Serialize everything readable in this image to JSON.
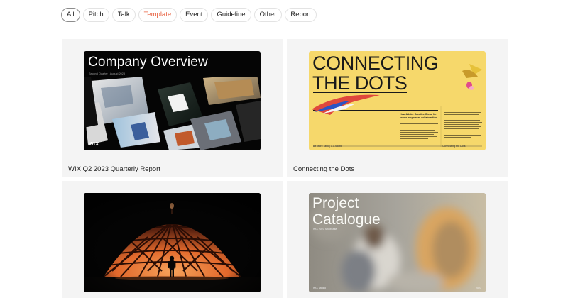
{
  "filters": [
    {
      "label": "All",
      "state": "selected"
    },
    {
      "label": "Pitch",
      "state": ""
    },
    {
      "label": "Talk",
      "state": ""
    },
    {
      "label": "Template",
      "state": "accent"
    },
    {
      "label": "Event",
      "state": ""
    },
    {
      "label": "Guideline",
      "state": ""
    },
    {
      "label": "Other",
      "state": ""
    },
    {
      "label": "Report",
      "state": ""
    }
  ],
  "colors": {
    "accent": "#e8603f",
    "card_bg": "#f4f4f4",
    "dots_yellow": "#f6d86b",
    "dome_orange": "#e9763a"
  },
  "cards": [
    {
      "caption": "WIX Q2 2023 Quarterly Report",
      "thumb": {
        "title": "Company Overview",
        "subtitle": "Second Quarter | August 2023",
        "brand": "WIX"
      }
    },
    {
      "caption": "Connecting the Dots",
      "thumb": {
        "title_line1": "CONNECTING",
        "title_line2": "THE DOTS",
        "intro": "How Adobe Creative Cloud for teams empowers collaboration",
        "footer_left": "Be More Task  |  1.1 Adobe",
        "footer_right": "Connecting the Dots"
      }
    },
    {
      "caption": "",
      "thumb": {}
    },
    {
      "caption": "",
      "thumb": {
        "title_line1": "Project",
        "title_line2": "Catalogue",
        "subtitle": "WIX 2023 Showcase",
        "footer_left": "WIX Studio",
        "footer_right": "2023"
      }
    }
  ]
}
